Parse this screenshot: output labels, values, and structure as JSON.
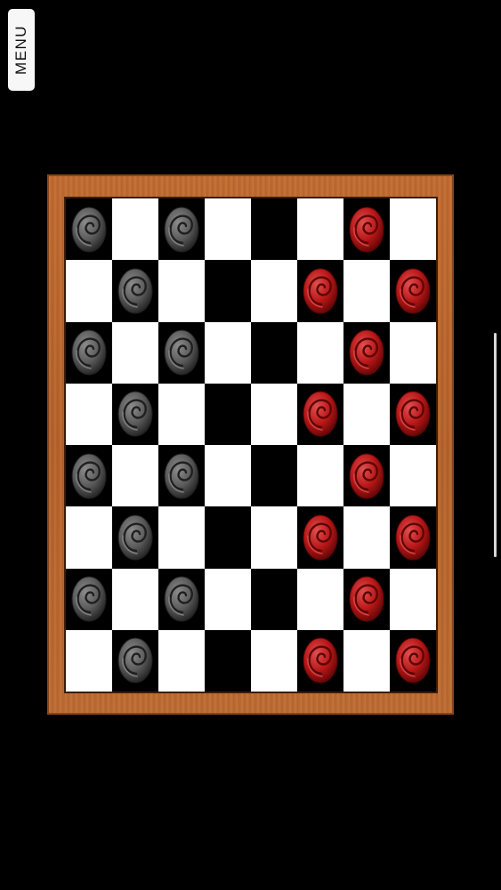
{
  "menu": {
    "label": "MENU"
  },
  "colors": {
    "background": "#000000",
    "board_frame": "#b8642b",
    "light_square": "#ffffff",
    "dark_square": "#000000",
    "gray_piece": "#5a5a5a",
    "red_piece": "#b81717"
  },
  "board": {
    "rows": 8,
    "cols": 8,
    "pieces": [
      [
        "gray",
        "",
        "gray",
        "",
        "",
        "",
        "red",
        ""
      ],
      [
        "",
        "gray",
        "",
        "",
        "",
        "red",
        "",
        "red"
      ],
      [
        "gray",
        "",
        "gray",
        "",
        "",
        "",
        "red",
        ""
      ],
      [
        "",
        "gray",
        "",
        "",
        "",
        "red",
        "",
        "red"
      ],
      [
        "gray",
        "",
        "gray",
        "",
        "",
        "",
        "red",
        ""
      ],
      [
        "",
        "gray",
        "",
        "",
        "",
        "red",
        "",
        "red"
      ],
      [
        "gray",
        "",
        "gray",
        "",
        "",
        "",
        "red",
        ""
      ],
      [
        "",
        "gray",
        "",
        "",
        "",
        "red",
        "",
        "red"
      ]
    ]
  }
}
